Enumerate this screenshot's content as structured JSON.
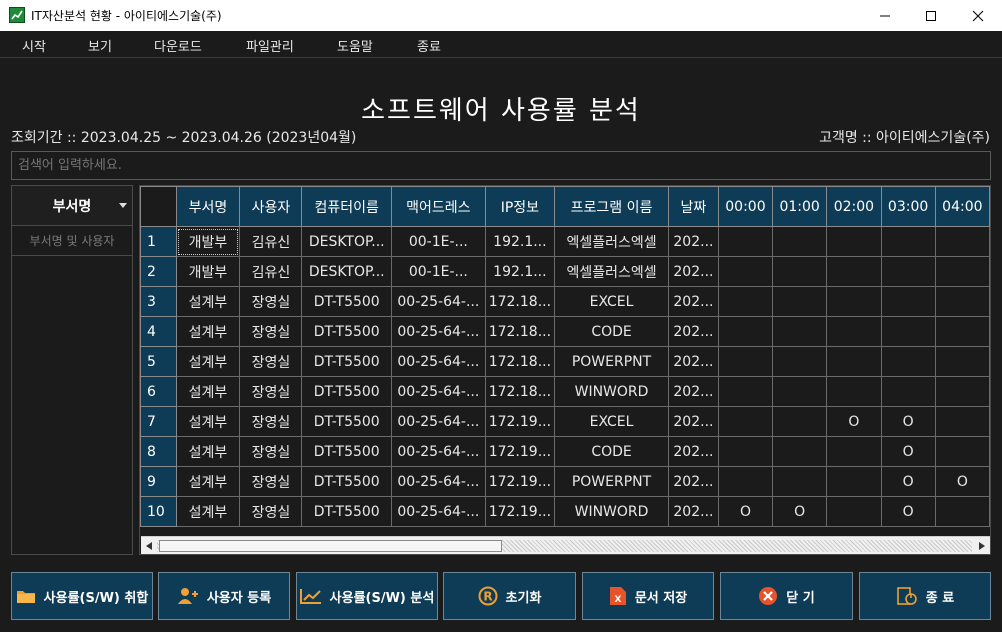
{
  "window": {
    "title": "IT자산분석 현황 - 아이티에스기술(주)"
  },
  "menu": [
    "시작",
    "보기",
    "다운로드",
    "파일관리",
    "도움말",
    "종료"
  ],
  "header": {
    "title": "소프트웨어 사용률 분석",
    "period": "조회기간 :: 2023.04.25 ~ 2023.04.26 (2023년04월)",
    "customer": "고객명 :: 아이티에스기술(주)"
  },
  "search": {
    "placeholder": "검색어 입력하세요."
  },
  "left_panel": {
    "dept_label": "부서명",
    "filter_placeholder": "부서명 및 사용자"
  },
  "grid": {
    "columns": [
      "부서명",
      "사용자",
      "컴퓨터이름",
      "맥어드레스",
      "IP정보",
      "프로그램 이름",
      "날짜",
      "00:00",
      "01:00",
      "02:00",
      "03:00",
      "04:00"
    ],
    "rows": [
      {
        "no": "1",
        "dept": "개발부",
        "user": "김유신",
        "pc": "DESKTOP...",
        "mac": "00-1E-...",
        "ip": "192.1...",
        "program": "엑셀플러스엑셀",
        "date": "202...",
        "h0": "",
        "h1": "",
        "h2": "",
        "h3": "",
        "h4": ""
      },
      {
        "no": "2",
        "dept": "개발부",
        "user": "김유신",
        "pc": "DESKTOP...",
        "mac": "00-1E-...",
        "ip": "192.1...",
        "program": "엑셀플러스엑셀",
        "date": "202...",
        "h0": "",
        "h1": "",
        "h2": "",
        "h3": "",
        "h4": ""
      },
      {
        "no": "3",
        "dept": "설계부",
        "user": "장영실",
        "pc": "DT-T5500",
        "mac": "00-25-64-...",
        "ip": "172.18...",
        "program": "EXCEL",
        "date": "202...",
        "h0": "",
        "h1": "",
        "h2": "",
        "h3": "",
        "h4": ""
      },
      {
        "no": "4",
        "dept": "설계부",
        "user": "장영실",
        "pc": "DT-T5500",
        "mac": "00-25-64-...",
        "ip": "172.18...",
        "program": "CODE",
        "date": "202...",
        "h0": "",
        "h1": "",
        "h2": "",
        "h3": "",
        "h4": ""
      },
      {
        "no": "5",
        "dept": "설계부",
        "user": "장영실",
        "pc": "DT-T5500",
        "mac": "00-25-64-...",
        "ip": "172.18...",
        "program": "POWERPNT",
        "date": "202...",
        "h0": "",
        "h1": "",
        "h2": "",
        "h3": "",
        "h4": ""
      },
      {
        "no": "6",
        "dept": "설계부",
        "user": "장영실",
        "pc": "DT-T5500",
        "mac": "00-25-64-...",
        "ip": "172.18...",
        "program": "WINWORD",
        "date": "202...",
        "h0": "",
        "h1": "",
        "h2": "",
        "h3": "",
        "h4": ""
      },
      {
        "no": "7",
        "dept": "설계부",
        "user": "장영실",
        "pc": "DT-T5500",
        "mac": "00-25-64-...",
        "ip": "172.19...",
        "program": "EXCEL",
        "date": "202...",
        "h0": "",
        "h1": "",
        "h2": "O",
        "h3": "O",
        "h4": ""
      },
      {
        "no": "8",
        "dept": "설계부",
        "user": "장영실",
        "pc": "DT-T5500",
        "mac": "00-25-64-...",
        "ip": "172.19...",
        "program": "CODE",
        "date": "202...",
        "h0": "",
        "h1": "",
        "h2": "",
        "h3": "O",
        "h4": ""
      },
      {
        "no": "9",
        "dept": "설계부",
        "user": "장영실",
        "pc": "DT-T5500",
        "mac": "00-25-64-...",
        "ip": "172.19...",
        "program": "POWERPNT",
        "date": "202...",
        "h0": "",
        "h1": "",
        "h2": "",
        "h3": "O",
        "h4": "O"
      },
      {
        "no": "10",
        "dept": "설계부",
        "user": "장영실",
        "pc": "DT-T5500",
        "mac": "00-25-64-...",
        "ip": "172.19...",
        "program": "WINWORD",
        "date": "202...",
        "h0": "O",
        "h1": "O",
        "h2": "",
        "h3": "O",
        "h4": ""
      }
    ]
  },
  "buttons": {
    "cancel_sw": "사용률(S/W) 취합",
    "add_user": "사용자 등록",
    "analyze_sw": "사용률(S/W) 분석",
    "reset": "초기화",
    "save_doc": "문서 저장",
    "close": "닫 기",
    "exit": "종 료"
  },
  "colors": {
    "accent": "#0e3b56",
    "background": "#1b1b1b",
    "folder_icon": "#f0a030",
    "excel_icon": "#e8542a",
    "close_icon": "#e8542a"
  }
}
